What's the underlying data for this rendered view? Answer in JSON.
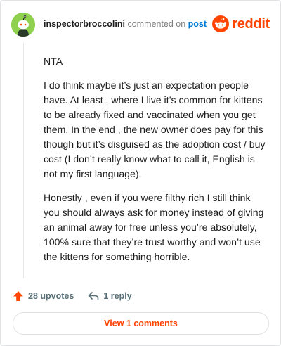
{
  "comment": {
    "username": "inspectorbroccolini",
    "commented_text": "commented on",
    "post_link": "post",
    "paragraphs": [
      "NTA",
      "I do think maybe it’s just an expectation people have. At least , where I live it’s common for kittens to be already fixed and vaccinated when you get them. In the end , the new owner does pay for this though but it’s disguised as the adoption cost / buy cost (I don’t really know what to call it, English is not my first language).",
      "Honestly , even if you were filthy rich I still think you should always ask for money instead of giving an animal away for free unless you’re absolutely, 100% sure that they’re trust worthy and won’t use the kittens for something horrible."
    ]
  },
  "brand": {
    "wordmark": "reddit",
    "color": "#ff4500"
  },
  "actions": {
    "upvotes_label": "28 upvotes",
    "reply_label": "1 reply",
    "view_comments_label": "View 1 comments"
  },
  "icons": {
    "avatar": "snoo-avatar-icon",
    "logo": "reddit-logo-icon",
    "upvote": "upvote-arrow-icon",
    "reply": "reply-arrow-icon"
  },
  "colors": {
    "link": "#0079d3",
    "upvote": "#ff4500",
    "avatar_bg": "#8fd14f"
  }
}
